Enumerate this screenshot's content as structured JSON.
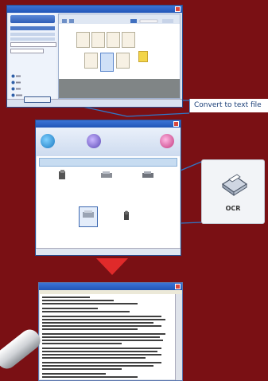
{
  "callout": {
    "text": "Convert to text file"
  },
  "ocr_card": {
    "label": "OCR"
  },
  "window1": {
    "title": "",
    "status": ""
  },
  "window2": {
    "title": "",
    "band_title": "",
    "toolbar": [],
    "items": [],
    "status": ""
  },
  "window3": {
    "title": ""
  },
  "icons": {
    "arrow": "down-triangle-icon",
    "ocr": "ocr-scanner-icon",
    "pen": "stylus-pen-icon"
  },
  "colors": {
    "background": "#7a1014",
    "arrow": "#e02a2a",
    "callout_text": "#1a3f78",
    "connector": "#2f78c8"
  }
}
